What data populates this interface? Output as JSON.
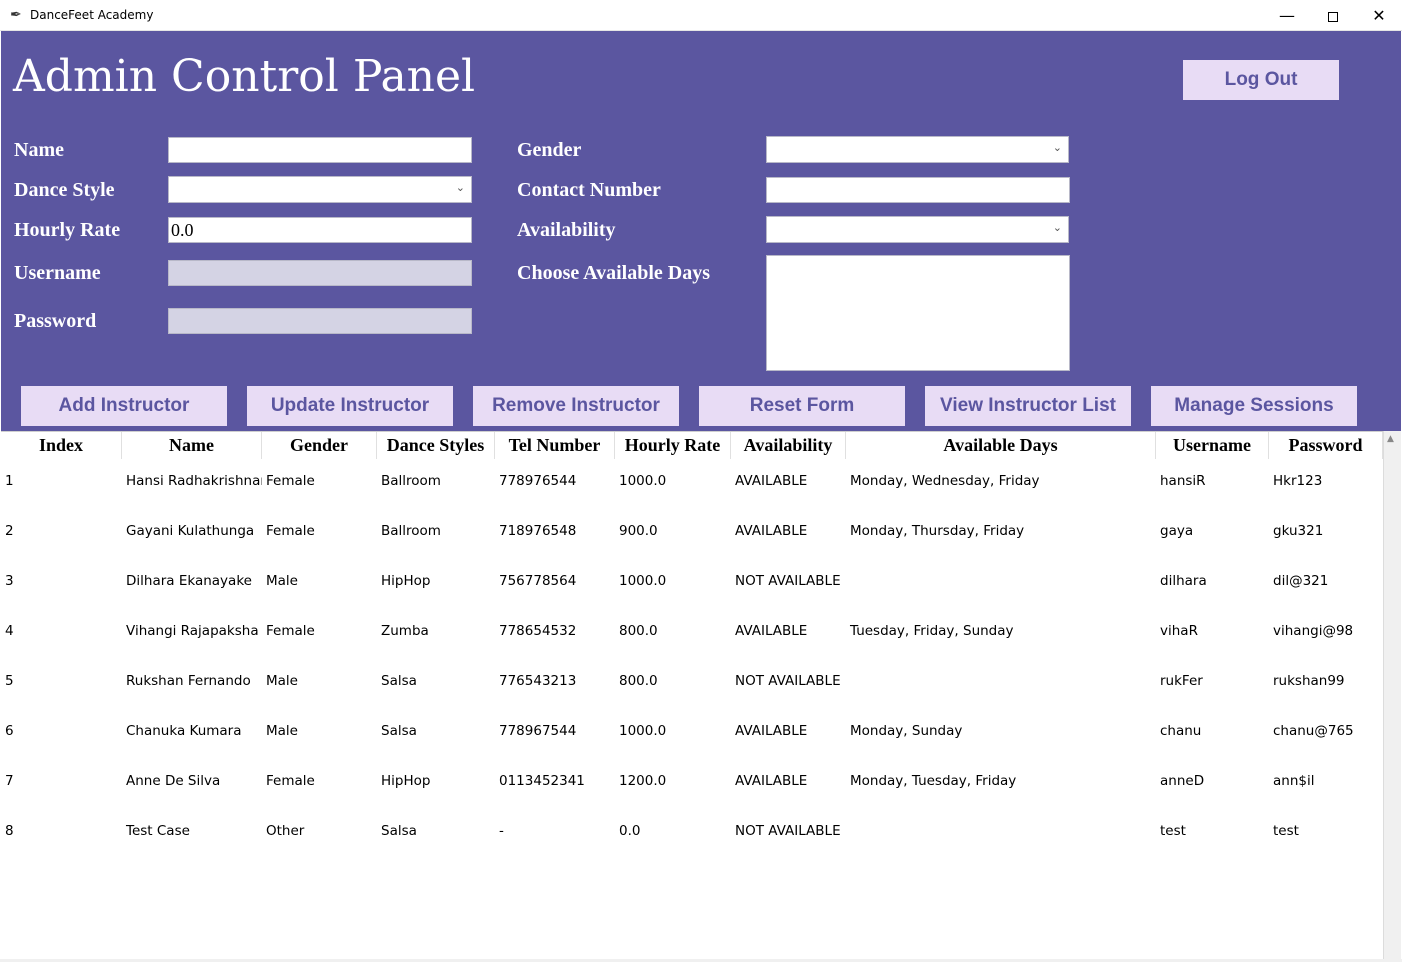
{
  "window": {
    "title": "DanceFeet Academy",
    "minimize": "—",
    "close": "✕"
  },
  "header": {
    "title": "Admin Control Panel",
    "logout_label": "Log Out"
  },
  "form": {
    "name_label": "Name",
    "name_value": "",
    "dance_style_label": "Dance Style",
    "dance_style_value": "",
    "hourly_rate_label": "Hourly Rate",
    "hourly_rate_value": "0.0",
    "username_label": "Username",
    "username_value": "",
    "password_label": "Password",
    "password_value": "",
    "gender_label": "Gender",
    "gender_value": "",
    "contact_label": "Contact Number",
    "contact_value": "",
    "availability_label": "Availability",
    "availability_value": "",
    "days_label": "Choose Available Days",
    "chevron": "⌄"
  },
  "actions": {
    "add": "Add Instructor",
    "update": "Update Instructor",
    "remove": "Remove Instructor",
    "reset": "Reset Form",
    "view": "View Instructor List",
    "sessions": "Manage Sessions"
  },
  "table": {
    "columns": [
      "Index",
      "Name",
      "Gender",
      "Dance Styles",
      "Tel Number",
      "Hourly Rate",
      "Availability",
      "Available Days",
      "Username",
      "Password"
    ],
    "rows": [
      [
        "1",
        "Hansi Radhakrishnan",
        "Female",
        "Ballroom",
        "778976544",
        "1000.0",
        "AVAILABLE",
        "Monday, Wednesday, Friday",
        "hansiR",
        "Hkr123"
      ],
      [
        "2",
        "Gayani Kulathunga",
        "Female",
        "Ballroom",
        "718976548",
        "900.0",
        "AVAILABLE",
        "Monday, Thursday, Friday",
        "gaya",
        "gku321"
      ],
      [
        "3",
        "Dilhara Ekanayake",
        "Male",
        "HipHop",
        "756778564",
        "1000.0",
        "NOT AVAILABLE",
        "",
        "dilhara",
        "dil@321"
      ],
      [
        "4",
        "Vihangi Rajapaksha",
        "Female",
        "Zumba",
        "778654532",
        "800.0",
        "AVAILABLE",
        "Tuesday, Friday, Sunday",
        "vihaR",
        "vihangi@98"
      ],
      [
        "5",
        "Rukshan Fernando",
        "Male",
        "Salsa",
        "776543213",
        "800.0",
        "NOT AVAILABLE",
        "",
        "rukFer",
        "rukshan99"
      ],
      [
        "6",
        "Chanuka Kumara",
        "Male",
        "Salsa",
        "778967544",
        "1000.0",
        "AVAILABLE",
        "Monday, Sunday",
        "chanu",
        "chanu@765"
      ],
      [
        "7",
        "Anne De Silva",
        "Female",
        "HipHop",
        "0113452341",
        "1200.0",
        "AVAILABLE",
        "Monday, Tuesday, Friday",
        "anneD",
        "ann$il"
      ],
      [
        "8",
        "Test Case",
        "Other",
        "Salsa",
        "-",
        "0.0",
        "NOT AVAILABLE",
        "",
        "test",
        "test"
      ]
    ]
  },
  "scrollbar": {
    "up_arrow": "▲"
  },
  "colors": {
    "panel": "#5b56a0",
    "button": "#e8dcf5",
    "button_text": "#5b56a0",
    "disabled_field": "#d4d3e4"
  }
}
